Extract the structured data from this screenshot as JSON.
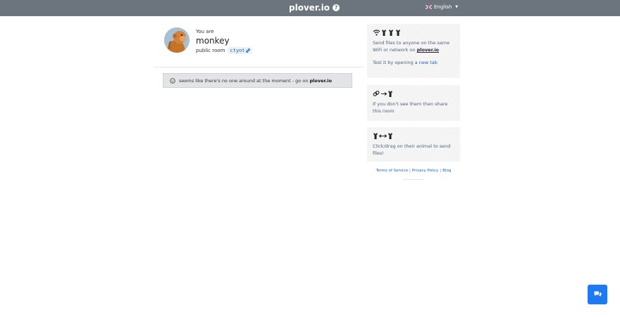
{
  "header": {
    "brand": "plover.io",
    "help_icon": "question-circle-icon",
    "language": "English",
    "language_icon": "flag-icon"
  },
  "profile": {
    "you_are": "You are",
    "username": "monkey",
    "room_type": "public room",
    "room_code": "ctyot",
    "avatar_icon": "monkey-avatar"
  },
  "alert": {
    "icon": "face-icon",
    "text": "seems like there's no one around at the moment - go on",
    "link": "plover.io"
  },
  "cards": [
    {
      "glyphs": "wifi-and-figures-icon",
      "text_before": "Send files to anyone on the same WiFi or network on",
      "strong": "plover.io",
      "test_text": "Test it by opening a",
      "test_link": "new tab"
    },
    {
      "glyphs": "link-arrow-figure-icon",
      "text": "If you don't see them then share this room"
    },
    {
      "glyphs": "figure-arrow-figure-icon",
      "text": "Click/drag on their animal to send files!"
    }
  ],
  "footer": {
    "links": [
      "Terms of Service",
      "Privacy Policy",
      "Blog"
    ],
    "separator": "|"
  },
  "chat": {
    "icon": "chat-bubbles-icon"
  },
  "colors": {
    "topbar": "#6c757d",
    "accent": "#1d7af3",
    "link": "#1a63c9",
    "alert_bg": "#e3e4e6",
    "card_bg": "#f6f6f7"
  }
}
